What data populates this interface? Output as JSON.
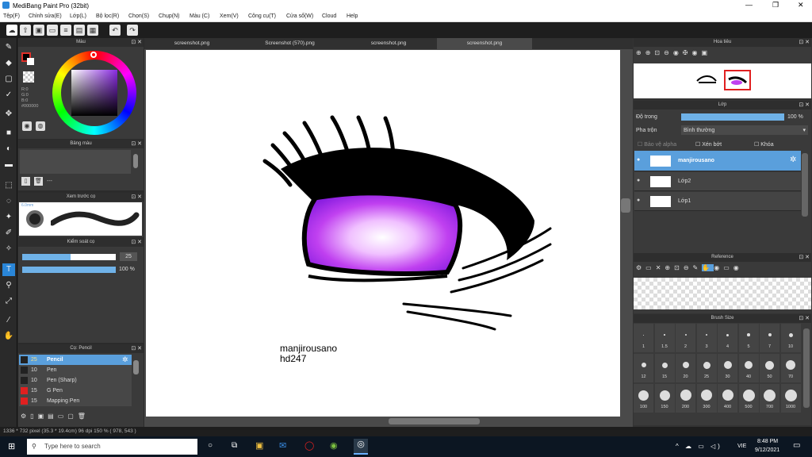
{
  "window": {
    "title": "MediBang Paint Pro (32bit)"
  },
  "menu": [
    "Tệp(F)",
    "Chỉnh sửa(E)",
    "Lớp(L)",
    "Bộ lọc(R)",
    "Chọn(S)",
    "Chụp(N)",
    "Màu (C)",
    "Xem(V)",
    "Công cụ(T)",
    "Cửa sổ(W)",
    "Cloud",
    "Help"
  ],
  "tabs": [
    "screenshot.png",
    "Screenshot (570).png",
    "screenshot.png",
    "screenshot.png"
  ],
  "color_panel": {
    "title": "Màu",
    "r": "R:0",
    "g": "G:0",
    "b": "B:0",
    "hex": "#000000",
    "primary": "#000000",
    "accent": "#e0302a"
  },
  "palette_panel": {
    "title": "Bảng màu",
    "dash": "---"
  },
  "preview_panel": {
    "title": "Xem trước cọ",
    "size": "6.0mm"
  },
  "brush_control": {
    "title": "Kiểm soát cọ",
    "size_value": "25",
    "opacity_value": "100 %",
    "size_fraction": 0.52,
    "opacity_fraction": 1.0
  },
  "brush_list": {
    "title": "Cọ: Pencil",
    "items": [
      {
        "size": "25",
        "name": "Pencil",
        "color": "#222222"
      },
      {
        "size": "10",
        "name": "Pen",
        "color": "#222222"
      },
      {
        "size": "10",
        "name": "Pen (Sharp)",
        "color": "#222222"
      },
      {
        "size": "15",
        "name": "G Pen",
        "color": "#e02020"
      },
      {
        "size": "15",
        "name": "Mapping Pen",
        "color": "#e02020"
      }
    ]
  },
  "navigator": {
    "title": "Hoa tiêu"
  },
  "layer_panel": {
    "title": "Lớp",
    "opacity_label": "Độ trong",
    "opacity_value": "100 %",
    "blend_label": "Pha trộn",
    "blend_value": "Bình thường",
    "protect_alpha": "Bảo vệ alpha",
    "clipping": "Xén bớt",
    "lock": "Khóa",
    "layers": [
      "manjirousano",
      "Lớp2",
      "Lớp1"
    ]
  },
  "reference": {
    "title": "Reference"
  },
  "brush_size": {
    "title": "Brush Size",
    "rows": [
      [
        "1",
        "1.5",
        "2",
        "3",
        "4",
        "5",
        "7",
        "10"
      ],
      [
        "12",
        "15",
        "20",
        "25",
        "30",
        "40",
        "50",
        "70"
      ],
      [
        "100",
        "150",
        "200",
        "300",
        "400",
        "500",
        "700",
        "1000"
      ]
    ]
  },
  "canvas_text": {
    "line1": "manjirousano",
    "line2": "hd247"
  },
  "status": "1336 * 732 pixel  (35.3 * 19.4cm)  96 dpi  150 %  ( 978, 543 )",
  "taskbar": {
    "search": "Type here to search",
    "time": "8:48 PM",
    "date": "9/12/2021",
    "lang": "VIE"
  }
}
